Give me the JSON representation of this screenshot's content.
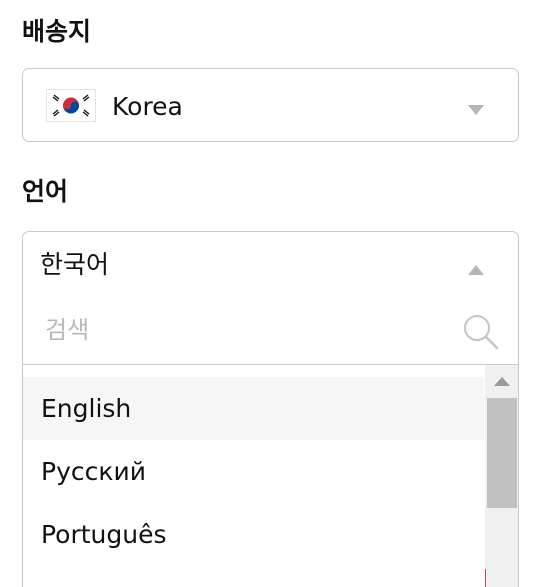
{
  "shipping": {
    "label": "배송지",
    "selected": "Korea",
    "flag_icon": "south-korea-flag-icon"
  },
  "language": {
    "label": "언어",
    "selected": "한국어",
    "search_placeholder": "검색",
    "options": [
      {
        "label": "English",
        "highlighted": true
      },
      {
        "label": "Русский",
        "highlighted": false
      },
      {
        "label": "Português",
        "highlighted": false
      }
    ]
  },
  "colors": {
    "border": "#c9c9c9",
    "caret": "#b5b5b5",
    "highlight_bg": "#f6f6f6",
    "scroll_thumb": "#c1c1c1",
    "korea_red": "#cd2e3a",
    "korea_blue": "#0047a0"
  }
}
